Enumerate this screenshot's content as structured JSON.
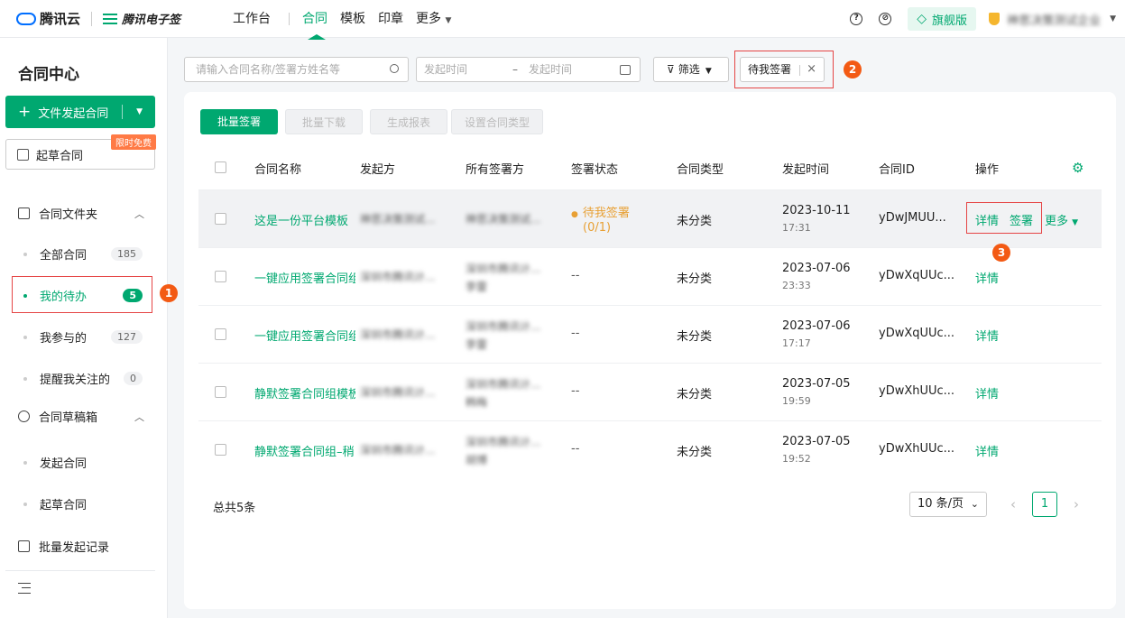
{
  "topbar": {
    "brand": "腾讯云",
    "product": "腾讯电子签",
    "nav": [
      "工作台",
      "合同",
      "模板",
      "印章",
      "更多"
    ],
    "nav_more_arrow": "▼",
    "help_icon": "?",
    "settings_icon": "⊘",
    "edition": "旗舰版",
    "company": "神思决策测试企业",
    "company_arrow": "▼"
  },
  "sidebar": {
    "title": "合同中心",
    "create_button": "文件发起合同",
    "draft_button": "起草合同",
    "free_badge": "限时免费",
    "folder_label": "合同文件夹",
    "folder_items": [
      {
        "label": "全部合同",
        "count": "185"
      },
      {
        "label": "我的待办",
        "count": "5"
      },
      {
        "label": "我参与的",
        "count": "127"
      },
      {
        "label": "提醒我关注的",
        "count": "0"
      }
    ],
    "drafts_label": "合同草稿箱",
    "drafts_items": [
      "发起合同",
      "起草合同"
    ],
    "batch_label": "批量发起记录"
  },
  "filters": {
    "search_placeholder": "请输入合同名称/签署方姓名等",
    "date_start": "发起时间",
    "date_sep": "–",
    "date_end": "发起时间",
    "filter_label": "筛选",
    "active_chip": "待我签署",
    "chip_close": "×"
  },
  "toolbar": {
    "batch_sign": "批量签署",
    "batch_download": "批量下载",
    "report": "生成报表",
    "set_type": "设置合同类型"
  },
  "table": {
    "columns": [
      "合同名称",
      "发起方",
      "所有签署方",
      "签署状态",
      "合同类型",
      "发起时间",
      "合同ID",
      "操作"
    ],
    "rows": [
      {
        "name": "这是一份平台模板",
        "initiator": "神思决策测试...",
        "signers1": "神思决策测试...",
        "signers2": "",
        "status": "待我签署",
        "status2": "(0/1)",
        "type": "未分类",
        "date": "2023-10-11",
        "time": "17:31",
        "id": "yDwJMUU...",
        "actions": [
          "详情",
          "签署",
          "更多"
        ]
      },
      {
        "name": "一键应用签署合同组",
        "initiator": "深圳市腾讯计...",
        "signers1": "深圳市腾讯计...",
        "signers2": "李雷",
        "status": "--",
        "status2": "",
        "type": "未分类",
        "date": "2023-07-06",
        "time": "23:33",
        "id": "yDwXqUUc...",
        "actions": [
          "详情"
        ]
      },
      {
        "name": "一键应用签署合同组",
        "initiator": "深圳市腾讯计...",
        "signers1": "深圳市腾讯计...",
        "signers2": "李雷",
        "status": "--",
        "status2": "",
        "type": "未分类",
        "date": "2023-07-06",
        "time": "17:17",
        "id": "yDwXqUUc...",
        "actions": [
          "详情"
        ]
      },
      {
        "name": "静默签署合同组模板",
        "initiator": "深圳市腾讯计...",
        "signers1": "深圳市腾讯计...",
        "signers2": "韩梅",
        "status": "--",
        "status2": "",
        "type": "未分类",
        "date": "2023-07-05",
        "time": "19:59",
        "id": "yDwXhUUc...",
        "actions": [
          "详情"
        ]
      },
      {
        "name": "静默签署合同组–稍",
        "initiator": "深圳市腾讯计...",
        "signers1": "深圳市腾讯计...",
        "signers2": "胡博",
        "status": "--",
        "status2": "",
        "type": "未分类",
        "date": "2023-07-05",
        "time": "19:52",
        "id": "yDwXhUUc...",
        "actions": [
          "详情"
        ]
      }
    ],
    "total": "总共5条",
    "page_size": "10 条/页",
    "page_size_arrow": "⌄",
    "prev": "‹",
    "page": "1",
    "next": "›"
  },
  "annotations": [
    "1",
    "2",
    "3"
  ],
  "colors": {
    "accent": "#00a870",
    "warning": "#e8a034",
    "marker": "#f35a14",
    "highlight_box": "#e54545"
  }
}
